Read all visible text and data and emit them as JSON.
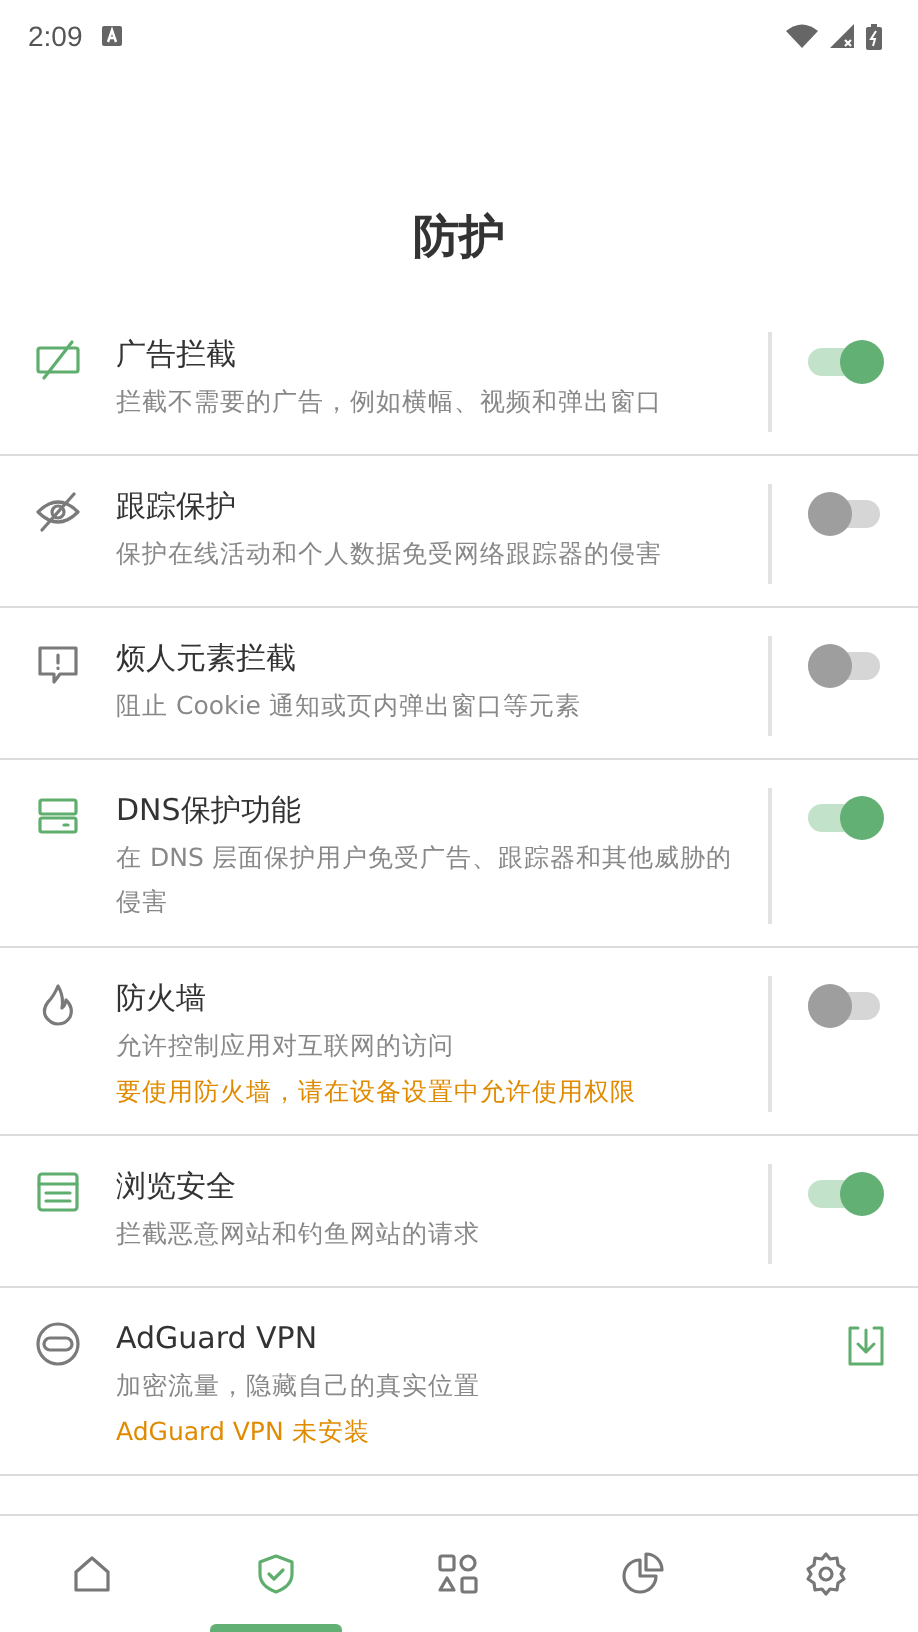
{
  "status_bar": {
    "time": "2:09"
  },
  "title": "防护",
  "items": [
    {
      "kind": "switch",
      "title": "广告拦截",
      "description": "拦截不需要的广告，例如横幅、视频和弹出窗口",
      "on": true
    },
    {
      "kind": "switch",
      "title": "跟踪保护",
      "description": "保护在线活动和个人数据免受网络跟踪器的侵害",
      "on": false
    },
    {
      "kind": "switch",
      "title": "烦人元素拦截",
      "description": "阻止 Cookie 通知或页内弹出窗口等元素",
      "on": false
    },
    {
      "kind": "switch",
      "title": "DNS保护功能",
      "description": "在 DNS 层面保护用户免受广告、跟踪器和其他威胁的侵害",
      "on": true
    },
    {
      "kind": "switch",
      "title": "防火墙",
      "description": "允许控制应用对互联网的访问",
      "warning": "要使用防火墙，请在设备设置中允许使用权限",
      "on": false
    },
    {
      "kind": "switch",
      "title": "浏览安全",
      "description": "拦截恶意网站和钓鱼网站的请求",
      "on": true
    },
    {
      "kind": "install",
      "title": "AdGuard VPN",
      "description": "加密流量，隐藏自己的真实位置",
      "warning": "AdGuard VPN 未安装",
      "on": false
    }
  ],
  "nav": [
    {
      "selected": false
    },
    {
      "selected": true
    },
    {
      "selected": false
    },
    {
      "selected": false
    },
    {
      "selected": false
    }
  ]
}
